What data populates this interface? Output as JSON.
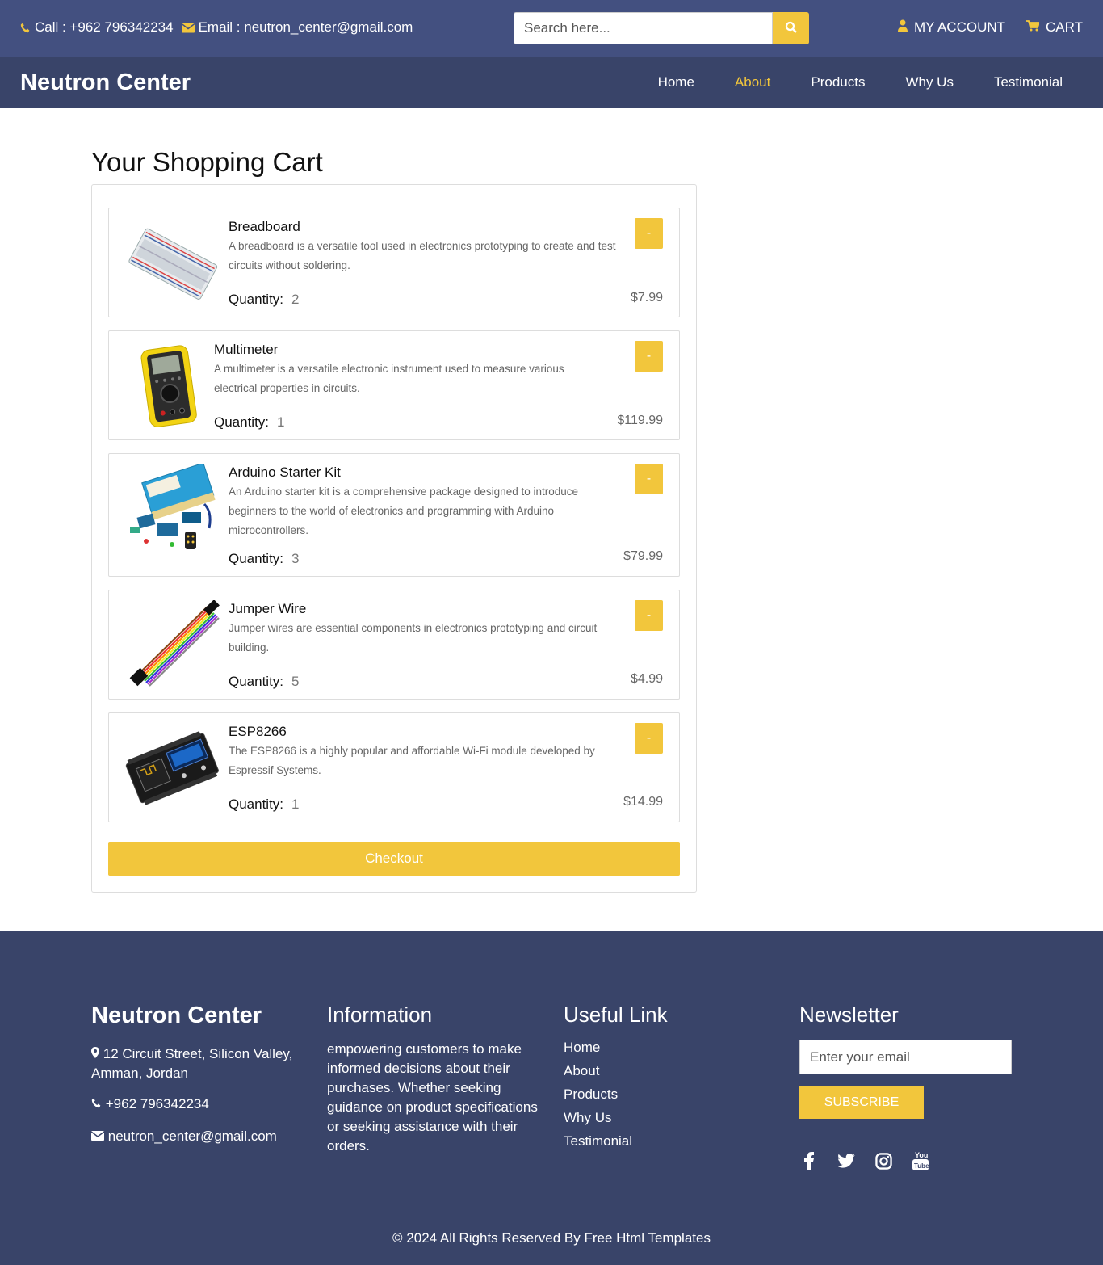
{
  "topbar": {
    "phone": "Call : +962 796342234",
    "email": "Email : neutron_center@gmail.com",
    "search_placeholder": "Search here...",
    "account": "MY ACCOUNT",
    "cart": "CART"
  },
  "nav": {
    "brand": "Neutron Center",
    "items": [
      "Home",
      "About",
      "Products",
      "Why Us",
      "Testimonial"
    ],
    "active": "About"
  },
  "cart": {
    "title": "Your Shopping Cart",
    "qty_label": "Quantity:",
    "remove_label": "-",
    "checkout": "Checkout",
    "items": [
      {
        "name": "Breadboard",
        "desc": "A breadboard is a versatile tool used in electronics prototyping to create and test circuits without soldering.",
        "qty": "2",
        "price": "$7.99",
        "icon": "breadboard-image"
      },
      {
        "name": "Multimeter",
        "desc": "A multimeter is a versatile electronic instrument used to measure various electrical properties in circuits.",
        "qty": "1",
        "price": "$119.99",
        "icon": "multimeter-image"
      },
      {
        "name": "Arduino Starter Kit",
        "desc": "An Arduino starter kit is a comprehensive package designed to introduce beginners to the world of electronics and programming with Arduino microcontrollers.",
        "qty": "3",
        "price": "$79.99",
        "icon": "arduino-kit-image"
      },
      {
        "name": "Jumper Wire",
        "desc": "Jumper wires are essential components in electronics prototyping and circuit building.",
        "qty": "5",
        "price": "$4.99",
        "icon": "jumper-wire-image"
      },
      {
        "name": "ESP8266",
        "desc": "The ESP8266 is a highly popular and affordable Wi-Fi module developed by Espressif Systems.",
        "qty": "1",
        "price": "$14.99",
        "icon": "esp8266-image"
      }
    ]
  },
  "footer": {
    "brand": "Neutron Center",
    "address": "12 Circuit Street, Silicon Valley, Amman, Jordan",
    "phone": "+962 796342234",
    "email": "neutron_center@gmail.com",
    "info_title": "Information",
    "info_text": "empowering customers to make informed decisions about their purchases. Whether seeking guidance on product specifications or seeking assistance with their orders.",
    "links_title": "Useful Link",
    "links": [
      "Home",
      "About",
      "Products",
      "Why Us",
      "Testimonial"
    ],
    "newsletter_title": "Newsletter",
    "email_placeholder": "Enter your email",
    "subscribe": "SUBSCRIBE",
    "social": [
      "facebook-icon",
      "twitter-icon",
      "instagram-icon",
      "youtube-icon"
    ],
    "copyright": "© 2024 All Rights Reserved By Free Html Templates"
  },
  "colors": {
    "accent": "#f2c63c",
    "topbar": "#435080",
    "nav": "#394469"
  }
}
